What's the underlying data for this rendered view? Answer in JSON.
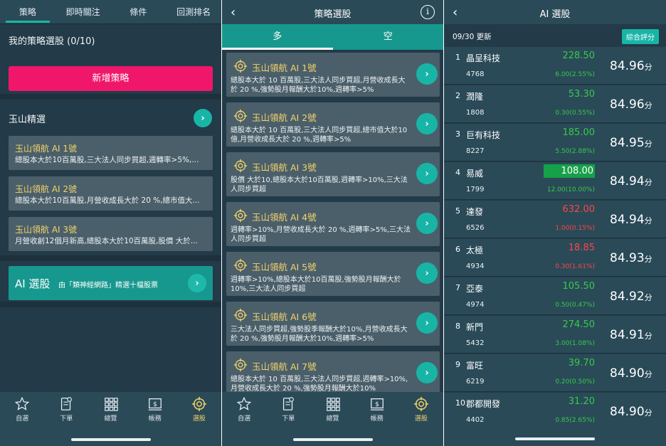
{
  "panel1": {
    "tabs": [
      "策略",
      "即時關注",
      "條件",
      "回測排名"
    ],
    "my_strategies": "我的策略選股 (0/10)",
    "add_button": "新增策略",
    "section_title": "玉山精選",
    "cards": [
      {
        "title": "玉山領航 AI 1號",
        "desc": "總股本大於10百萬股,三大法人同步買超,週轉率>5%,..."
      },
      {
        "title": "玉山領航 AI 2號",
        "desc": "總股本大於10百萬股,月營收成長大於 20 %,總市值大..."
      },
      {
        "title": "玉山領航 AI 3號",
        "desc": "月營收創12個月新高,總股本大於10百萬股,股價 大於..."
      }
    ],
    "ai_card": {
      "title": "AI 選股",
      "desc": "由「類神經網路」精選十檔股票"
    }
  },
  "nav": {
    "items": [
      {
        "label": "自選",
        "icon": "star-icon"
      },
      {
        "label": "下單",
        "icon": "order-icon"
      },
      {
        "label": "總覽",
        "icon": "grid-icon"
      },
      {
        "label": "帳務",
        "icon": "account-icon"
      },
      {
        "label": "選股",
        "icon": "target-icon"
      }
    ]
  },
  "panel2": {
    "title": "策略選股",
    "tabs": [
      "多",
      "空"
    ],
    "cards": [
      {
        "title": "玉山領航 AI 1號",
        "desc": "總股本大於 10 百萬股,三大法人同步買超,月營收成長大於 20 %,強勢股月報酬大於10%,週轉率>5%"
      },
      {
        "title": "玉山領航 AI 2號",
        "desc": "總股本大於 10 百萬股,三大法人同步買超,總市值大於10億,月營收成長大於 20 %,週轉率>5%"
      },
      {
        "title": "玉山領航 AI 3號",
        "desc": "股價 大於10,總股本大於10百萬股,週轉率>10%,三大法人同步買超"
      },
      {
        "title": "玉山領航 AI 4號",
        "desc": "週轉率>10%,月營收成長大於 20 %,週轉率>5%,三大法人同步買超"
      },
      {
        "title": "玉山領航 AI 5號",
        "desc": "週轉率>10%,總股本大於10百萬股,強勢股月報酬大於10%,三大法人同步買超"
      },
      {
        "title": "玉山領航 AI 6號",
        "desc": "三大法人同步買超,強勢股季報酬大於10%,月營收成長大於 20 %,強勢股月報酬大於10%,週轉率>5%"
      },
      {
        "title": "玉山領航 AI 7號",
        "desc": "總股本大於 10 百萬股,三大法人同步買超,週轉率>10%,月營收成長大於 20 %,強勢股月報酬大於10%"
      }
    ]
  },
  "panel3": {
    "title": "AI 選股",
    "update": "09/30 更新",
    "sort_button": "綜合評分",
    "score_unit": "分",
    "rows": [
      {
        "rank": "1",
        "name": "晶呈科技",
        "code": "4768",
        "price": "228.50",
        "change": "6.00(2.55%)",
        "dir": "up",
        "score": "84.96"
      },
      {
        "rank": "2",
        "name": "潤隆",
        "code": "1808",
        "price": "53.30",
        "change": "0.30(0.55%)",
        "dir": "up",
        "score": "84.96"
      },
      {
        "rank": "3",
        "name": "巨有科技",
        "code": "8227",
        "price": "185.00",
        "change": "5.50(2.88%)",
        "dir": "up",
        "score": "84.95"
      },
      {
        "rank": "4",
        "name": "易威",
        "code": "1799",
        "price": "108.00",
        "change": "12.00(10.00%)",
        "dir": "up",
        "score": "84.94",
        "highlight": true
      },
      {
        "rank": "5",
        "name": "達發",
        "code": "6526",
        "price": "632.00",
        "change": "1.00(0.15%)",
        "dir": "down",
        "score": "84.94"
      },
      {
        "rank": "6",
        "name": "太極",
        "code": "4934",
        "price": "18.85",
        "change": "0.30(1.61%)",
        "dir": "down",
        "score": "84.93"
      },
      {
        "rank": "7",
        "name": "亞泰",
        "code": "4974",
        "price": "105.50",
        "change": "0.50(0.47%)",
        "dir": "up",
        "score": "84.92"
      },
      {
        "rank": "8",
        "name": "新門",
        "code": "5432",
        "price": "274.50",
        "change": "3.00(1.08%)",
        "dir": "up",
        "score": "84.91"
      },
      {
        "rank": "9",
        "name": "富旺",
        "code": "6219",
        "price": "39.70",
        "change": "0.20(0.50%)",
        "dir": "up",
        "score": "84.90"
      },
      {
        "rank": "10",
        "name": "郡都開發",
        "code": "4402",
        "price": "31.20",
        "change": "0.85(2.65%)",
        "dir": "up",
        "score": "84.90"
      }
    ]
  },
  "colors": {
    "accent": "#18b5a6",
    "pink": "#f0176a",
    "gold": "#f2d36b",
    "up": "#37c94a",
    "down": "#ff4545"
  }
}
